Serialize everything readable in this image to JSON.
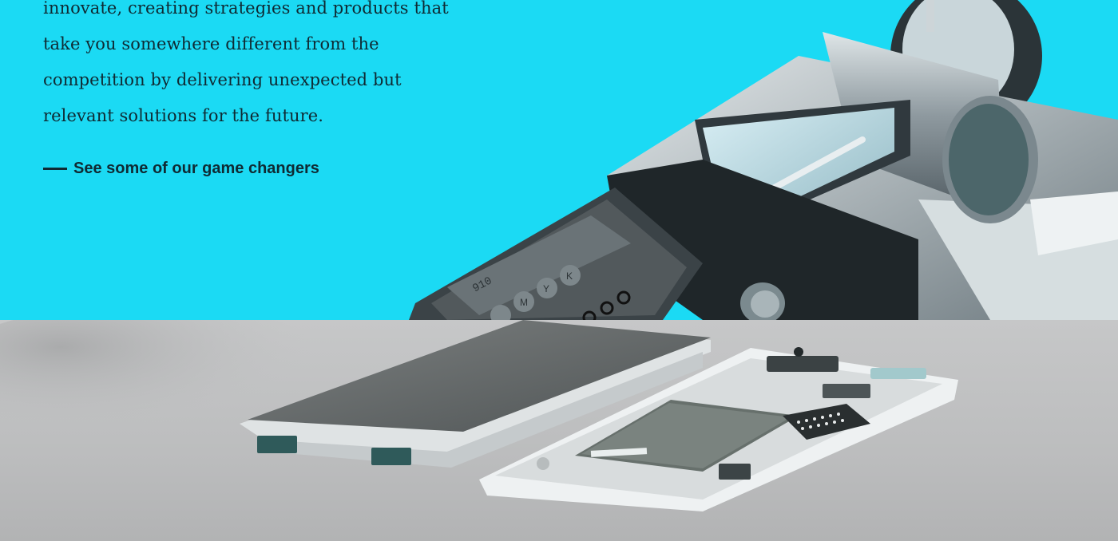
{
  "intro": {
    "lines": [
      "innovate, creating strategies and products that",
      "take you somewhere different from the",
      "competition by delivering unexpected but",
      "relevant solutions for the future."
    ]
  },
  "cta": {
    "label": "See some of our game changers"
  },
  "printer": {
    "model": "910",
    "ink_keys": [
      "C",
      "M",
      "Y",
      "K"
    ]
  },
  "colors": {
    "hero_background": "#1bdaf4",
    "text": "#0f2a33",
    "lower_background": "#c0c1c2"
  },
  "images": {
    "top": "printer-device-photo",
    "bottom": "disassembled-phone-photo"
  }
}
